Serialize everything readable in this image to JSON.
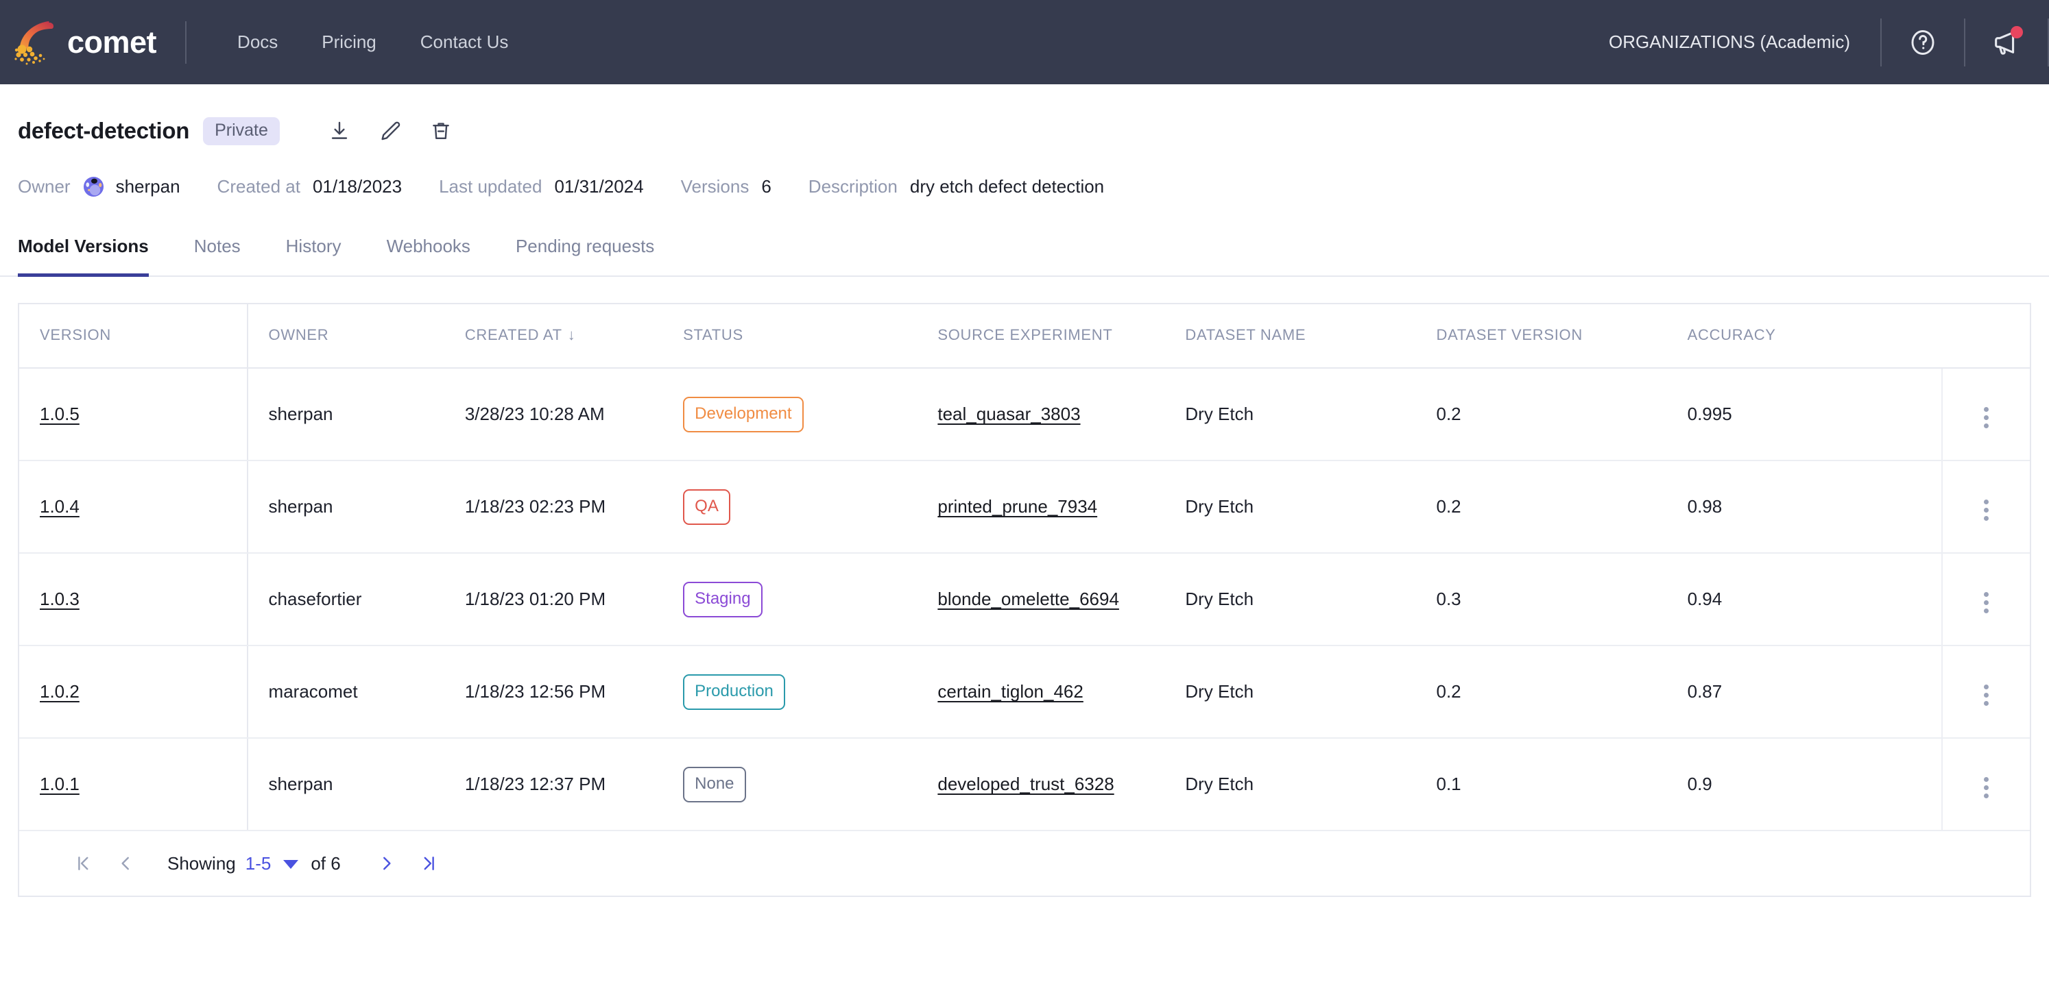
{
  "topnav": {
    "brand": "comet",
    "links": [
      {
        "label": "Docs"
      },
      {
        "label": "Pricing"
      },
      {
        "label": "Contact Us"
      }
    ],
    "organizations": "ORGANIZATIONS (Academic)",
    "help_icon": "question-mark-circle-icon",
    "announcements_icon": "megaphone-icon",
    "has_notification": true,
    "background": "#363b4e"
  },
  "header": {
    "title": "defect-detection",
    "visibility_badge": "Private",
    "actions": [
      {
        "name": "download-button",
        "icon": "download-icon"
      },
      {
        "name": "edit-button",
        "icon": "pencil-icon"
      },
      {
        "name": "delete-button",
        "icon": "trash-icon"
      }
    ]
  },
  "meta": {
    "owner_label": "Owner",
    "owner_value": "sherpan",
    "created_label": "Created at",
    "created_value": "01/18/2023",
    "updated_label": "Last updated",
    "updated_value": "01/31/2024",
    "versions_label": "Versions",
    "versions_value": "6",
    "description_label": "Description",
    "description_value": "dry etch defect detection"
  },
  "tabs": [
    {
      "label": "Model Versions",
      "active": true
    },
    {
      "label": "Notes",
      "active": false
    },
    {
      "label": "History",
      "active": false
    },
    {
      "label": "Webhooks",
      "active": false
    },
    {
      "label": "Pending requests",
      "active": false
    }
  ],
  "table": {
    "columns": [
      "VERSION",
      "OWNER",
      "CREATED AT",
      "STATUS",
      "SOURCE EXPERIMENT",
      "DATASET NAME",
      "DATASET VERSION",
      "ACCURACY"
    ],
    "sort_column": "CREATED AT",
    "sort_glyph": "↓",
    "rows": [
      {
        "version": "1.0.5",
        "owner": "sherpan",
        "created_at": "3/28/23 10:28 AM",
        "status": "Development",
        "status_color": "#f08c43",
        "source_experiment": "teal_quasar_3803",
        "dataset_name": "Dry Etch",
        "dataset_version": "0.2",
        "accuracy": "0.995"
      },
      {
        "version": "1.0.4",
        "owner": "sherpan",
        "created_at": "1/18/23 02:23 PM",
        "status": "QA",
        "status_color": "#e0574c",
        "source_experiment": "printed_prune_7934",
        "dataset_name": "Dry Etch",
        "dataset_version": "0.2",
        "accuracy": "0.98"
      },
      {
        "version": "1.0.3",
        "owner": "chasefortier",
        "created_at": "1/18/23 01:20 PM",
        "status": "Staging",
        "status_color": "#8b4ad6",
        "source_experiment": "blonde_omelette_6694",
        "dataset_name": "Dry Etch",
        "dataset_version": "0.3",
        "accuracy": "0.94"
      },
      {
        "version": "1.0.2",
        "owner": "maracomet",
        "created_at": "1/18/23 12:56 PM",
        "status": "Production",
        "status_color": "#2a9aab",
        "source_experiment": "certain_tiglon_462",
        "dataset_name": "Dry Etch",
        "dataset_version": "0.2",
        "accuracy": "0.87"
      },
      {
        "version": "1.0.1",
        "owner": "sherpan",
        "created_at": "1/18/23 12:37 PM",
        "status": "None",
        "status_color": "#6b7389",
        "source_experiment": "developed_trust_6328",
        "dataset_name": "Dry Etch",
        "dataset_version": "0.1",
        "accuracy": "0.9"
      }
    ],
    "row_menu_icon": "kebab-menu-icon"
  },
  "pagination": {
    "first_icon": "first-page-icon",
    "prev_icon": "previous-page-icon",
    "showing_label": "Showing",
    "range": "1-5",
    "of_label": "of 6",
    "next_icon": "next-page-icon",
    "last_icon": "last-page-icon",
    "accent": "#4a52e0"
  }
}
